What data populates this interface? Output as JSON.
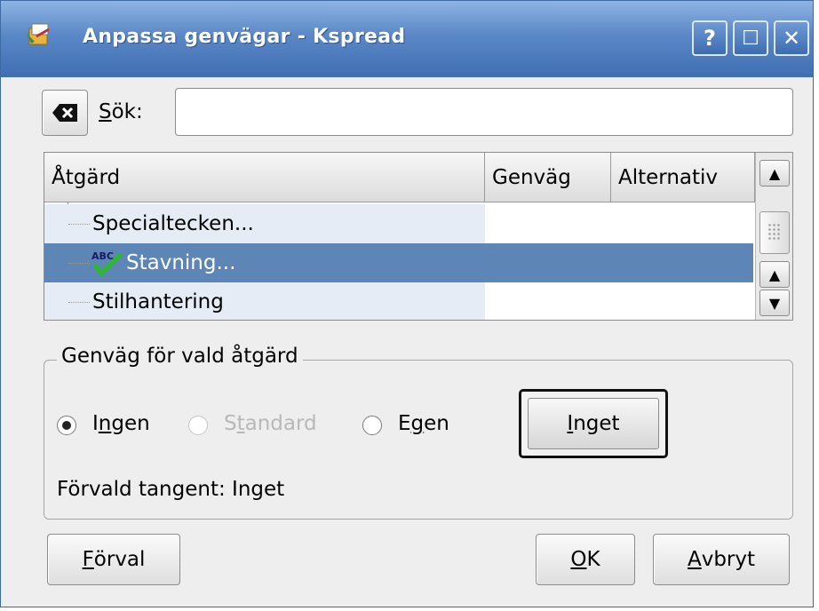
{
  "window": {
    "title": "Anpassa genvägar - Kspread",
    "controls": {
      "help": "?",
      "maximize": "☐",
      "close": "✕"
    }
  },
  "search": {
    "clear_icon": "clear-left-icon",
    "label_accel": "S",
    "label_rest": "ök:",
    "value": ""
  },
  "list": {
    "columns": [
      "Åtgärd",
      "Genväg",
      "Alternativ"
    ],
    "rows": [
      {
        "name": "Specialtecken...",
        "selected": false,
        "icon": ""
      },
      {
        "name": "Stavning...",
        "selected": true,
        "icon": "spellcheck-icon"
      },
      {
        "name": "Stilhantering",
        "selected": false,
        "icon": ""
      }
    ]
  },
  "shortcut_group": {
    "legend": "Genväg för vald åtgärd",
    "options": {
      "none": {
        "pre": "I",
        "accel": "n",
        "post": "gen",
        "checked": true,
        "enabled": true
      },
      "default": {
        "pre": "S",
        "accel": "t",
        "post": "andard",
        "checked": false,
        "enabled": false
      },
      "custom": {
        "pre": "E",
        "accel": "g",
        "post": "en",
        "checked": false,
        "enabled": true
      }
    },
    "key_button": {
      "accel": "I",
      "rest": "nget"
    },
    "default_key": "Förvald tangent: Inget"
  },
  "buttons": {
    "defaults": {
      "accel": "F",
      "rest": "örval"
    },
    "ok": {
      "accel": "O",
      "rest": "K"
    },
    "cancel": {
      "accel": "A",
      "rest": "vbryt"
    }
  },
  "colors": {
    "titlebar": "#4a79bd",
    "selection": "#5d86b6",
    "row_alt": "#e6ecf5"
  }
}
